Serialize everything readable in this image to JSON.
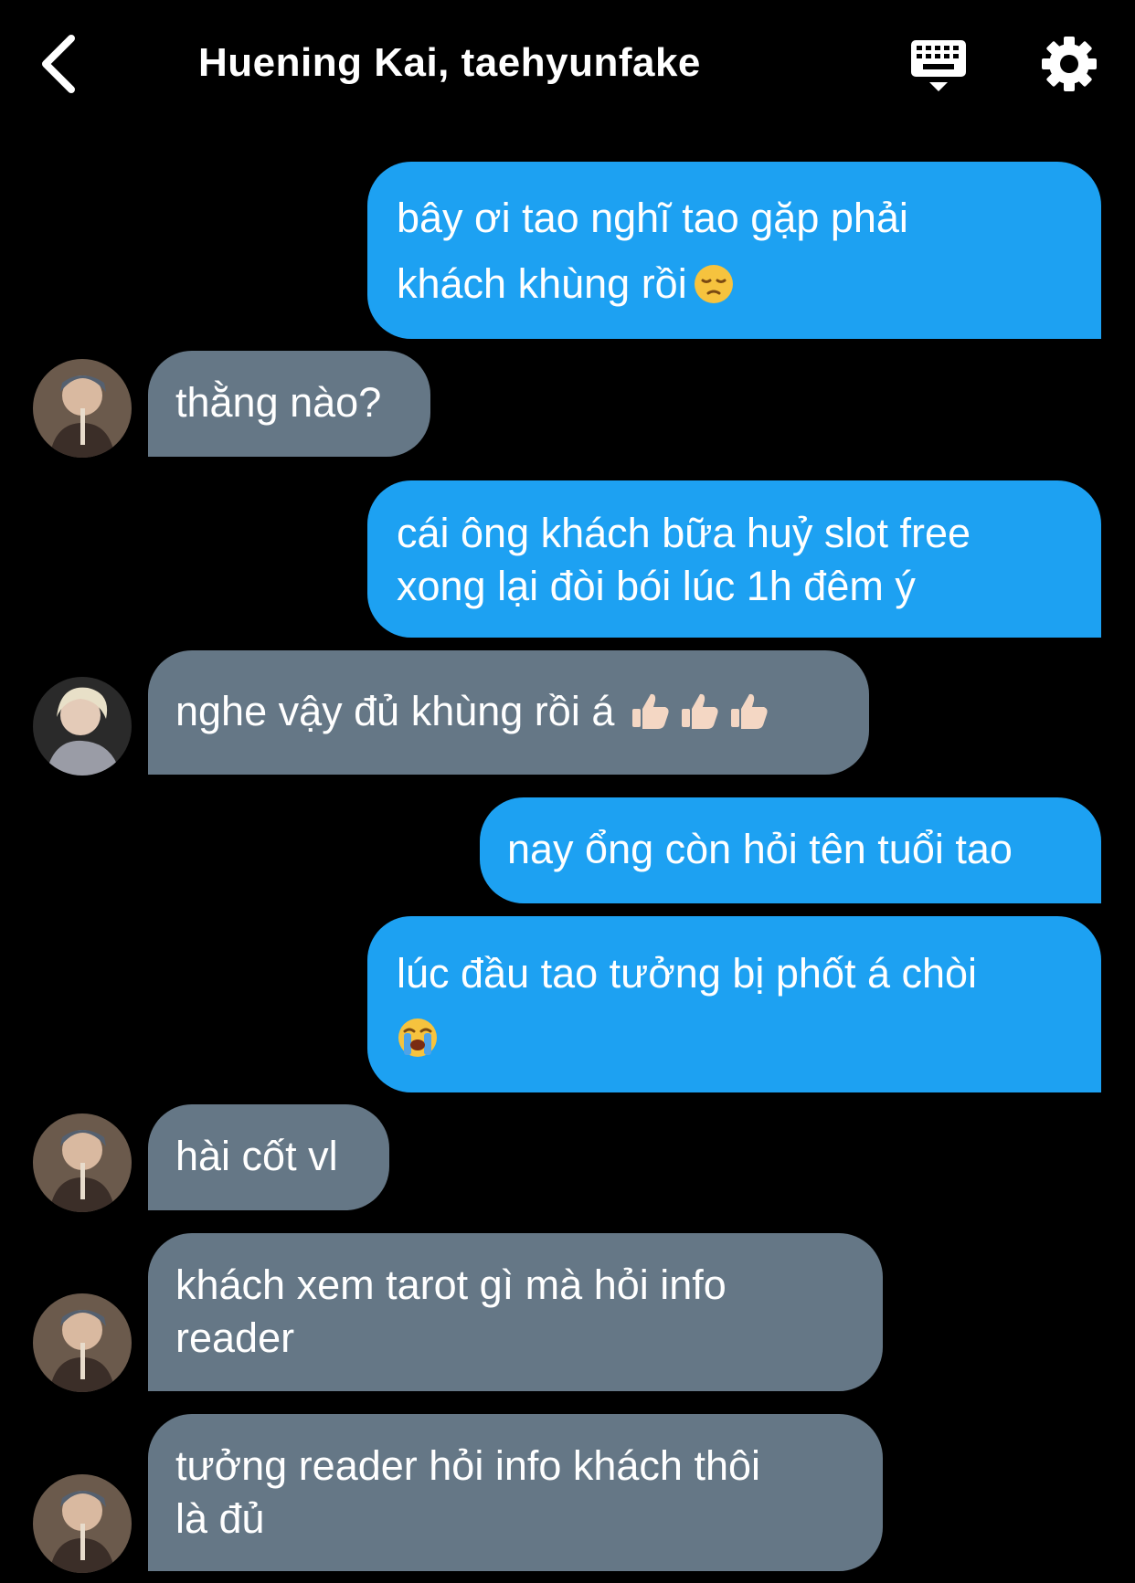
{
  "header": {
    "title": "Huening Kai, taehyunfake",
    "back_icon": "chevron-left-icon",
    "keyboard_icon": "keyboard-icon",
    "settings_icon": "gear-icon"
  },
  "colors": {
    "background": "#000000",
    "outgoing_bubble": "#1da1f2",
    "incoming_bubble": "#657786",
    "text": "#ffffff"
  },
  "messages": [
    {
      "direction": "outgoing",
      "lines": [
        "bây ơi tao nghĩ tao gặp phải",
        "khách khùng rồi"
      ],
      "emoji": "pensive-face-emoji"
    },
    {
      "direction": "incoming",
      "lines": [
        "thằng nào?"
      ]
    },
    {
      "direction": "outgoing",
      "lines": [
        "cái ông khách bữa huỷ slot free",
        "xong lại đòi bói lúc 1h đêm ý"
      ]
    },
    {
      "direction": "incoming",
      "lines": [
        "nghe vậy đủ khùng rồi á"
      ],
      "emoji": "thumbs-up-emoji x3"
    },
    {
      "direction": "outgoing",
      "lines": [
        "nay ổng còn hỏi tên tuổi tao"
      ]
    },
    {
      "direction": "outgoing",
      "lines": [
        "lúc đầu tao tưởng bị phốt á chòi"
      ],
      "emoji": "loudly-crying-face-emoji"
    },
    {
      "direction": "incoming",
      "lines": [
        "hài cốt vl"
      ]
    },
    {
      "direction": "incoming",
      "lines": [
        "khách xem tarot gì mà hỏi info",
        "reader"
      ]
    },
    {
      "direction": "incoming",
      "lines": [
        "tưởng reader hỏi info khách thôi",
        "là đủ"
      ]
    }
  ]
}
